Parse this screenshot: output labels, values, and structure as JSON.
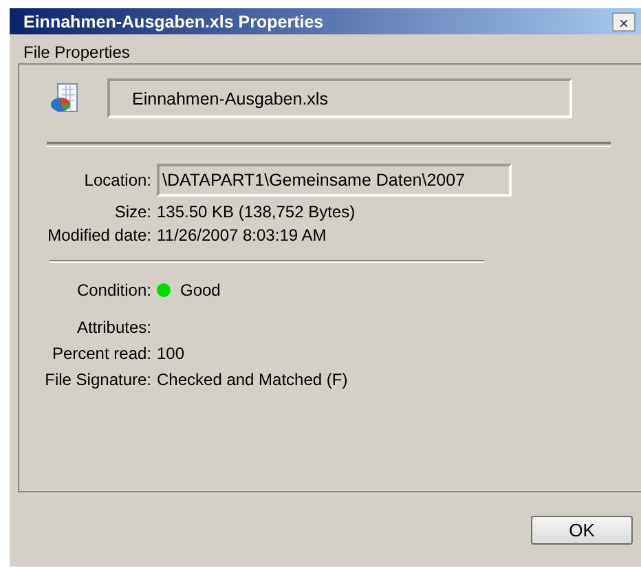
{
  "window": {
    "title": "Einnahmen-Ausgaben.xls Properties",
    "close": "×"
  },
  "tabs": [
    {
      "label": "File Properties",
      "selected": true
    }
  ],
  "file_name": "Einnahmen-Ausgaben.xls",
  "sections": [
    {
      "rows": [
        {
          "label": "Location:",
          "kind": "field",
          "value": "\\DATAPART1\\Gemeinsame Daten\\2007"
        },
        {
          "label": "Size:",
          "kind": "text",
          "value": "135.50 KB (138,752 Bytes)"
        },
        {
          "label": "Modified date:",
          "kind": "text",
          "value": "11/26/2007 8:03:19 AM"
        }
      ]
    },
    {
      "rows": [
        {
          "label": "Condition:",
          "kind": "status",
          "value": "Good",
          "color": "#00dd00"
        },
        {
          "label": "Attributes:",
          "kind": "text"
        },
        {
          "label": "Percent read:",
          "kind": "text",
          "value": "100"
        },
        {
          "label": "File Signature:",
          "kind": "text",
          "value": "Checked and Matched (F)"
        }
      ]
    }
  ],
  "buttons": [
    "OK"
  ]
}
